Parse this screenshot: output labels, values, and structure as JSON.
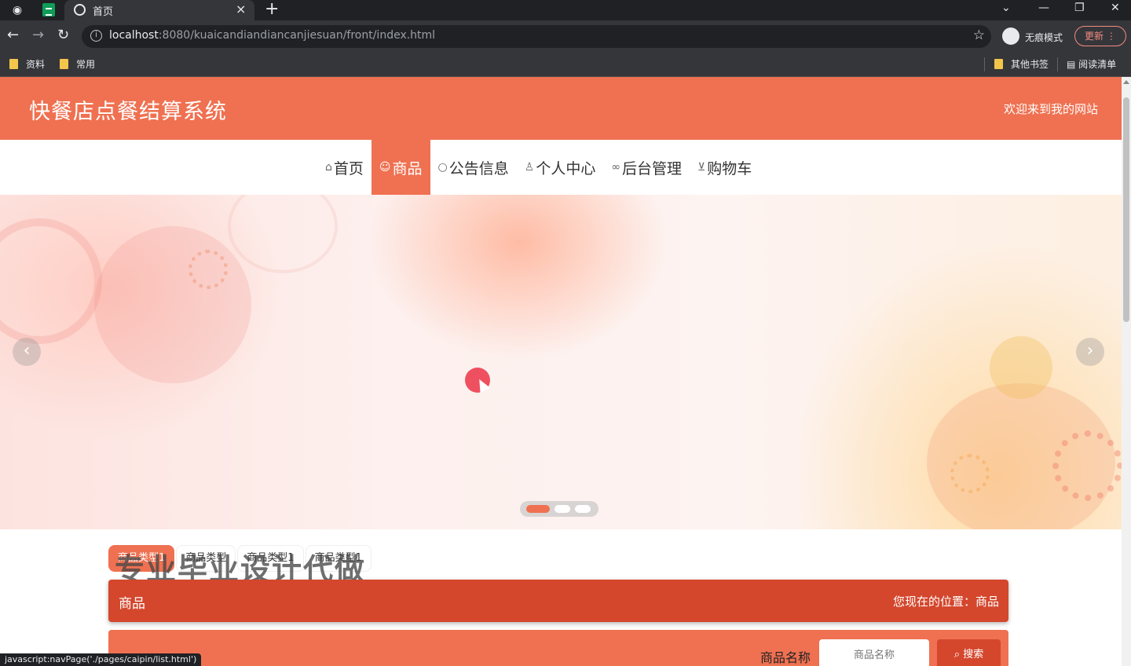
{
  "browser": {
    "tab_title": "首页",
    "tab_close": "×",
    "new_tab": "+",
    "url_host": "localhost",
    "url_rest": ":8080/kuaicandiandiancanjiesuan/front/index.html",
    "incognito_label": "无痕模式",
    "update_label": "更新",
    "bookmarks": [
      "资料",
      "常用"
    ],
    "other_bookmarks": "其他书签",
    "reading_list": "阅读清单",
    "status_url": "javascript:navPage('./pages/caipin/list.html')"
  },
  "site": {
    "title": "快餐店点餐结算系统",
    "welcome": "欢迎来到我的网站",
    "nav": [
      {
        "label": "首页",
        "icon": "home-icon"
      },
      {
        "label": "商品",
        "icon": "goods-icon",
        "active": true
      },
      {
        "label": "公告信息",
        "icon": "notice-icon"
      },
      {
        "label": "个人中心",
        "icon": "user-icon"
      },
      {
        "label": "后台管理",
        "icon": "link-icon"
      },
      {
        "label": "购物车",
        "icon": "cart-icon"
      }
    ]
  },
  "categories": [
    "商品类型1",
    "商品类型",
    "商品类型1",
    "商品类型1"
  ],
  "watermark": "专业毕业设计代做",
  "breadcrumb": {
    "title": "商品",
    "location": "您现在的位置：商品"
  },
  "search": {
    "label": "商品名称",
    "placeholder": "商品名称",
    "button": "搜索"
  },
  "colors": {
    "primary": "#ef7151",
    "dark": "#d4472d"
  }
}
